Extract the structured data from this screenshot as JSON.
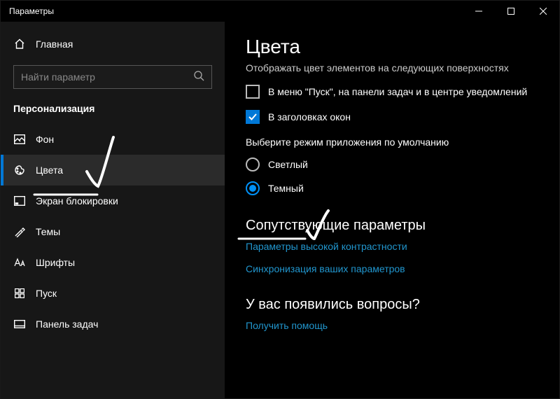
{
  "window": {
    "title": "Параметры"
  },
  "sidebar": {
    "home": "Главная",
    "searchPlaceholder": "Найти параметр",
    "section": "Персонализация",
    "items": [
      {
        "label": "Фон"
      },
      {
        "label": "Цвета"
      },
      {
        "label": "Экран блокировки"
      },
      {
        "label": "Темы"
      },
      {
        "label": "Шрифты"
      },
      {
        "label": "Пуск"
      },
      {
        "label": "Панель задач"
      }
    ]
  },
  "content": {
    "title": "Цвета",
    "surfacesLabel": "Отображать цвет элементов на следующих поверхностях",
    "cbStart": "В меню \"Пуск\", на панели задач и в центре уведомлений",
    "cbTitlebars": "В заголовках окон",
    "appModeLabel": "Выберите режим приложения по умолчанию",
    "radioLight": "Светлый",
    "radioDark": "Темный",
    "relatedHeader": "Сопутствующие параметры",
    "linkContrast": "Параметры высокой контрастности",
    "linkSync": "Синхронизация ваших параметров",
    "questionsHeader": "У вас появились вопросы?",
    "linkHelp": "Получить помощь"
  }
}
